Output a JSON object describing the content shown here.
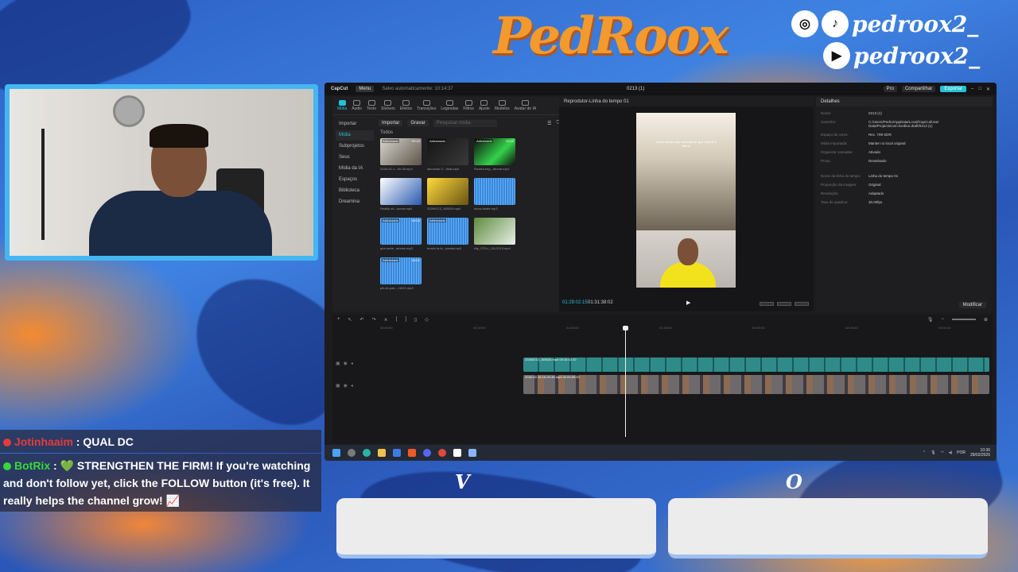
{
  "overlay": {
    "brand": "PedRoox",
    "handles": [
      "pedroox2_",
      "pedroox2_"
    ],
    "vote_left": "V",
    "vote_right": "O"
  },
  "editor": {
    "app_name": "CapCut",
    "menu_label": "Menu",
    "saved_status": "Salvo automaticamente: 10:14:37",
    "project_title": "0213 (1)",
    "pro_label": "Pro",
    "share_label": "Compartilhar",
    "export_label": "Exportar",
    "tools": [
      "Mídia",
      "Áudio",
      "Texto",
      "Stickers",
      "Efeitos",
      "Transições",
      "Legendas",
      "Filtros",
      "Ajuste",
      "Modelos",
      "Avatar de IA"
    ],
    "sidebar": [
      "Importar",
      "Mídia",
      "Subprojetos",
      "Seus",
      "Mídia da IA",
      "Espaços",
      "Biblioteca",
      "Dreamina"
    ],
    "import_label": "Importar",
    "record_label": "Gravar",
    "search_placeholder": "Pesquisar mídia",
    "all_label": "Todos",
    "media": [
      {
        "badge": "Adicionado",
        "dur": "02:25",
        "name": "2026-02-1...00-36.mp4",
        "kind": "vid1"
      },
      {
        "badge": "Adicionado",
        "dur": "",
        "name": "lancando O...final.mp4",
        "kind": "vid2"
      },
      {
        "badge": "Adicionado",
        "dur": "00:11",
        "name": "Roxeta eng...ahorta.mp4",
        "kind": "vid3"
      },
      {
        "badge": "",
        "dur": "",
        "name": "",
        "kind": "none"
      },
      {
        "badge": "",
        "dur": "",
        "name": "Reality sh...ucrow.mp4",
        "kind": "vid4"
      },
      {
        "badge": "",
        "dur": "",
        "name": "20260213_165024.mp4",
        "kind": "vid5"
      },
      {
        "badge": "",
        "dur": "",
        "name": "snow-beate.mp3",
        "kind": "audio"
      },
      {
        "badge": "",
        "dur": "",
        "name": "",
        "kind": "none"
      },
      {
        "badge": "Adicionado",
        "dur": "00:03",
        "name": "que-sorte...ainnse.mp3",
        "kind": "audio"
      },
      {
        "badge": "Adicionado",
        "dur": "",
        "name": "movie-la-fu...panda.mp3",
        "kind": "audio"
      },
      {
        "badge": "",
        "dur": "",
        "name": "clip_STILL_GA.2019.mp4",
        "kind": "vid6"
      },
      {
        "badge": "",
        "dur": "",
        "name": "",
        "kind": "none"
      },
      {
        "badge": "Adicionado",
        "dur": "00:01",
        "name": "piii-de-pab...11022.mp3",
        "kind": "audio"
      }
    ],
    "player_title": "Reprodutor-Linha do tempo 01",
    "preview_caption": "vocês acham que vai explicar que essa é a última",
    "time_current": "01:29:02:15",
    "time_total": "01:31:38:02",
    "details_title": "Detalhes",
    "details": [
      {
        "k": "Nome:",
        "v": "0213 (1)"
      },
      {
        "k": "Caminho:",
        "v": "C:/Users/Pedro/AppData/Local/CapCut/User Data/Projects/com.lveditor.draft/0213 (1)"
      },
      {
        "k": "Espaço de cores:",
        "v": "Rec. 709 SDR"
      },
      {
        "k": "Mídia importada:",
        "v": "Manter no local original"
      },
      {
        "k": "Organizar camadas:",
        "v": "Ativado"
      },
      {
        "k": "Proxy:",
        "v": "Desativado"
      },
      {
        "k": "Nome da linha do tempo:",
        "v": "Linha do tempo 01"
      },
      {
        "k": "Proporção da imagem:",
        "v": "Original"
      },
      {
        "k": "Resolução:",
        "v": "Adaptado"
      },
      {
        "k": "Taxa de quadros:",
        "v": "30.00fps"
      }
    ],
    "modify_label": "Modificar",
    "ruler": [
      "00:00:00",
      "00:30:00",
      "01:00:00",
      "01:30:00",
      "02:00:00",
      "02:30:00",
      "03:00:00"
    ],
    "clip_a_label": "20260213_165024.mp4  00:15:42:10",
    "clip_b_label": "2026-02-16 16-00-36.mp4  00:09:09:20",
    "taskbar_lang": "POR",
    "taskbar_time": "10:36",
    "taskbar_date": "28/02/2026"
  },
  "chat": [
    {
      "user": "Jotinhaaim",
      "text": ": QUAL DC",
      "color": "#e23b3b"
    },
    {
      "user": "BotRix",
      "text": ": 💚 STRENGTHEN THE FIRM! If you're watching and don't follow yet, click the FOLLOW button (it's free). It really helps the channel grow! 📈",
      "color": "#36d93a"
    }
  ],
  "colors": {
    "accent": "#27c1d6",
    "cam_border": "#44b7f2"
  }
}
